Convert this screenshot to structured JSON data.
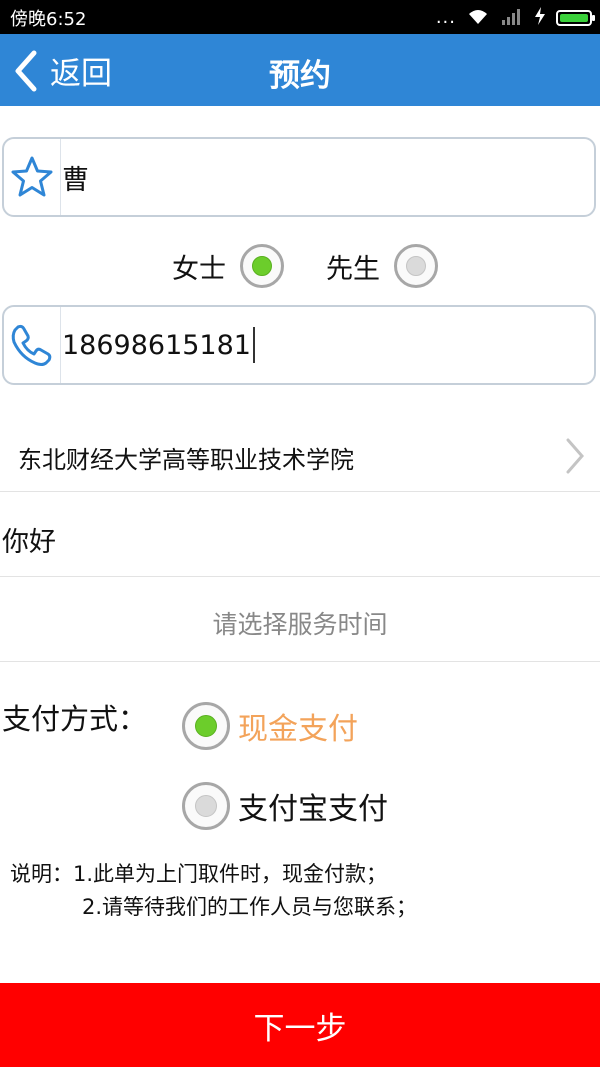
{
  "status_bar": {
    "time": "傍晚6:52",
    "dots": "...",
    "battery_color": "#3bd13b"
  },
  "header": {
    "back_label": "返回",
    "title": "预约",
    "bar_color": "#2f86d6"
  },
  "name_field": {
    "value": "曹"
  },
  "gender": {
    "options": [
      {
        "label": "女士",
        "selected": true
      },
      {
        "label": "先生",
        "selected": false
      }
    ]
  },
  "phone_field": {
    "value": "18698615181"
  },
  "school": {
    "label": "东北财经大学高等职业技术学院"
  },
  "note": {
    "value": "你好"
  },
  "service_time": {
    "placeholder": "请选择服务时间"
  },
  "payment": {
    "label": "支付方式：",
    "options": [
      {
        "label": "现金支付",
        "selected": true
      },
      {
        "label": "支付宝支付",
        "selected": false
      }
    ],
    "selected_color": "#f3a35a"
  },
  "instructions": {
    "line1": "说明：1.此单为上门取件时，现金付款；",
    "line2": "2.请等待我们的工作人员与您联系；"
  },
  "next_button": {
    "label": "下一步",
    "color": "#ff0000"
  }
}
